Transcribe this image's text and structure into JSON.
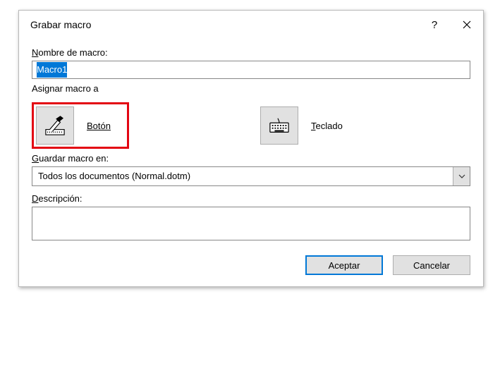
{
  "dialog": {
    "title": "Grabar macro"
  },
  "fields": {
    "name_label": "Nombre de macro:",
    "name_value": "Macro1",
    "assign_label": "Asignar macro a",
    "button_label": "Botón",
    "keyboard_label": "Teclado",
    "store_label": "Guardar macro en:",
    "store_value": "Todos los documentos (Normal.dotm)",
    "description_label": "Descripción:",
    "description_value": ""
  },
  "buttons": {
    "ok": "Aceptar",
    "cancel": "Cancelar"
  },
  "icons": {
    "help": "?",
    "button_icon": "hammer-button-icon",
    "keyboard_icon": "keyboard-icon",
    "close_icon": "close-icon",
    "chevron_icon": "chevron-down-icon"
  }
}
